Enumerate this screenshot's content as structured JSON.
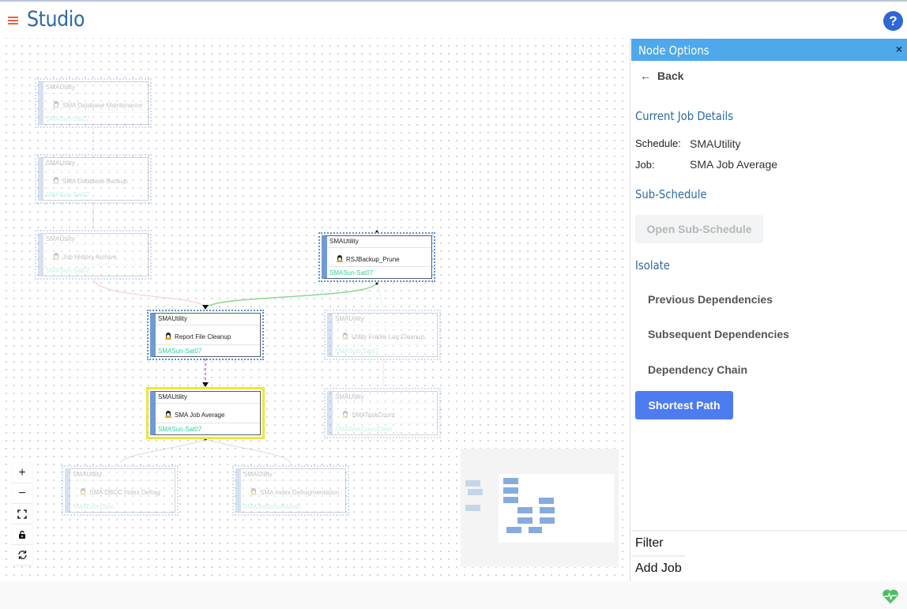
{
  "header": {
    "title": "Studio",
    "menu_icon": "hamburger-menu-icon",
    "help_icon": "question-circle-icon"
  },
  "canvas": {
    "nodes": [
      {
        "id": "n1",
        "schedule": "SMAUtility",
        "job": "SMA Database Maintenance",
        "calendar": "SMASun-Sat07",
        "state": "faded"
      },
      {
        "id": "n2",
        "schedule": "SMAUtility",
        "job": "SMA Database Backup",
        "calendar": "SMASun-Sat07",
        "state": "faded"
      },
      {
        "id": "n3",
        "schedule": "SMAUtility",
        "job": "Job History Archive",
        "calendar": "SMASun-Sat07",
        "state": "faded"
      },
      {
        "id": "n4",
        "schedule": "SMAUtility",
        "job": "RSJBackup_Prune",
        "calendar": "SMASun-Sat07",
        "state": "active"
      },
      {
        "id": "n5",
        "schedule": "SMAUtility",
        "job": "Report File Cleanup",
        "calendar": "SMASun-Sat07",
        "state": "active"
      },
      {
        "id": "n6",
        "schedule": "SMAUtility",
        "job": "Utility Folder Log Cleanup",
        "calendar": "SMASun-Sat07",
        "state": "faded"
      },
      {
        "id": "n7",
        "schedule": "SMAUtility",
        "job": "SMA Job Average",
        "calendar": "SMASun-Sat07",
        "state": "selected"
      },
      {
        "id": "n8",
        "schedule": "SMAUtility",
        "job": "SMATaskCount",
        "calendar": "SMATaskCountDays",
        "state": "faded"
      },
      {
        "id": "n9",
        "schedule": "SMAUtility",
        "job": "SMA DBCC Index Defrag",
        "calendar": "SMAEverySun",
        "state": "faded"
      },
      {
        "id": "n10",
        "schedule": "SMAUtility",
        "job": "SMA Index Defragmentation",
        "calendar": "SMA3rdSunofMonth",
        "state": "faded"
      }
    ],
    "zoom_controls": [
      {
        "name": "zoom-in",
        "icon": "plus-icon",
        "glyph": "+"
      },
      {
        "name": "zoom-out",
        "icon": "minus-icon",
        "glyph": "−"
      },
      {
        "name": "fit-view",
        "icon": "fit-screen-icon",
        "glyph": "⛶"
      },
      {
        "name": "lock",
        "icon": "lock-icon",
        "glyph": "🔒"
      },
      {
        "name": "refresh",
        "icon": "refresh-icon",
        "glyph": "↻"
      }
    ]
  },
  "panel": {
    "title": "Node Options",
    "close_glyph": "×",
    "back_label": "Back",
    "back_glyph": "🡐",
    "current_job_title": "Current Job Details",
    "schedule_label": "Schedule:",
    "schedule_value": "SMAUtility",
    "job_label": "Job:",
    "job_value": "SMA Job Average",
    "sub_schedule_title": "Sub-Schedule",
    "open_sub_schedule_label": "Open Sub-Schedule",
    "isolate_title": "Isolate",
    "isolate_options": [
      "Previous Dependencies",
      "Subsequent Dependencies",
      "Dependency Chain"
    ],
    "shortest_path_label": "Shortest Path",
    "filter_label": "Filter",
    "add_job_label": "Add Job"
  },
  "footer": {
    "status_icon": "heartbeat-icon",
    "status_color": "#4cbf62"
  },
  "colors": {
    "brand_title": "#2f6aa8",
    "panel_header": "#4fa7ec",
    "primary_button": "#4d7cf0",
    "selected_node_border": "#f0ec28",
    "calendar_text": "#2fcf9a"
  }
}
